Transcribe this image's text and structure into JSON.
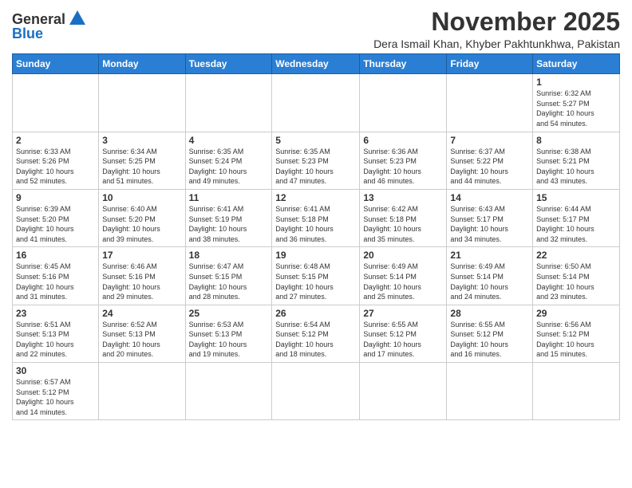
{
  "header": {
    "logo_general": "General",
    "logo_blue": "Blue",
    "month_title": "November 2025",
    "subtitle": "Dera Ismail Khan, Khyber Pakhtunkhwa, Pakistan"
  },
  "weekdays": [
    "Sunday",
    "Monday",
    "Tuesday",
    "Wednesday",
    "Thursday",
    "Friday",
    "Saturday"
  ],
  "weeks": [
    [
      {
        "day": "",
        "info": ""
      },
      {
        "day": "",
        "info": ""
      },
      {
        "day": "",
        "info": ""
      },
      {
        "day": "",
        "info": ""
      },
      {
        "day": "",
        "info": ""
      },
      {
        "day": "",
        "info": ""
      },
      {
        "day": "1",
        "info": "Sunrise: 6:32 AM\nSunset: 5:27 PM\nDaylight: 10 hours\nand 54 minutes."
      }
    ],
    [
      {
        "day": "2",
        "info": "Sunrise: 6:33 AM\nSunset: 5:26 PM\nDaylight: 10 hours\nand 52 minutes."
      },
      {
        "day": "3",
        "info": "Sunrise: 6:34 AM\nSunset: 5:25 PM\nDaylight: 10 hours\nand 51 minutes."
      },
      {
        "day": "4",
        "info": "Sunrise: 6:35 AM\nSunset: 5:24 PM\nDaylight: 10 hours\nand 49 minutes."
      },
      {
        "day": "5",
        "info": "Sunrise: 6:35 AM\nSunset: 5:23 PM\nDaylight: 10 hours\nand 47 minutes."
      },
      {
        "day": "6",
        "info": "Sunrise: 6:36 AM\nSunset: 5:23 PM\nDaylight: 10 hours\nand 46 minutes."
      },
      {
        "day": "7",
        "info": "Sunrise: 6:37 AM\nSunset: 5:22 PM\nDaylight: 10 hours\nand 44 minutes."
      },
      {
        "day": "8",
        "info": "Sunrise: 6:38 AM\nSunset: 5:21 PM\nDaylight: 10 hours\nand 43 minutes."
      }
    ],
    [
      {
        "day": "9",
        "info": "Sunrise: 6:39 AM\nSunset: 5:20 PM\nDaylight: 10 hours\nand 41 minutes."
      },
      {
        "day": "10",
        "info": "Sunrise: 6:40 AM\nSunset: 5:20 PM\nDaylight: 10 hours\nand 39 minutes."
      },
      {
        "day": "11",
        "info": "Sunrise: 6:41 AM\nSunset: 5:19 PM\nDaylight: 10 hours\nand 38 minutes."
      },
      {
        "day": "12",
        "info": "Sunrise: 6:41 AM\nSunset: 5:18 PM\nDaylight: 10 hours\nand 36 minutes."
      },
      {
        "day": "13",
        "info": "Sunrise: 6:42 AM\nSunset: 5:18 PM\nDaylight: 10 hours\nand 35 minutes."
      },
      {
        "day": "14",
        "info": "Sunrise: 6:43 AM\nSunset: 5:17 PM\nDaylight: 10 hours\nand 34 minutes."
      },
      {
        "day": "15",
        "info": "Sunrise: 6:44 AM\nSunset: 5:17 PM\nDaylight: 10 hours\nand 32 minutes."
      }
    ],
    [
      {
        "day": "16",
        "info": "Sunrise: 6:45 AM\nSunset: 5:16 PM\nDaylight: 10 hours\nand 31 minutes."
      },
      {
        "day": "17",
        "info": "Sunrise: 6:46 AM\nSunset: 5:16 PM\nDaylight: 10 hours\nand 29 minutes."
      },
      {
        "day": "18",
        "info": "Sunrise: 6:47 AM\nSunset: 5:15 PM\nDaylight: 10 hours\nand 28 minutes."
      },
      {
        "day": "19",
        "info": "Sunrise: 6:48 AM\nSunset: 5:15 PM\nDaylight: 10 hours\nand 27 minutes."
      },
      {
        "day": "20",
        "info": "Sunrise: 6:49 AM\nSunset: 5:14 PM\nDaylight: 10 hours\nand 25 minutes."
      },
      {
        "day": "21",
        "info": "Sunrise: 6:49 AM\nSunset: 5:14 PM\nDaylight: 10 hours\nand 24 minutes."
      },
      {
        "day": "22",
        "info": "Sunrise: 6:50 AM\nSunset: 5:14 PM\nDaylight: 10 hours\nand 23 minutes."
      }
    ],
    [
      {
        "day": "23",
        "info": "Sunrise: 6:51 AM\nSunset: 5:13 PM\nDaylight: 10 hours\nand 22 minutes."
      },
      {
        "day": "24",
        "info": "Sunrise: 6:52 AM\nSunset: 5:13 PM\nDaylight: 10 hours\nand 20 minutes."
      },
      {
        "day": "25",
        "info": "Sunrise: 6:53 AM\nSunset: 5:13 PM\nDaylight: 10 hours\nand 19 minutes."
      },
      {
        "day": "26",
        "info": "Sunrise: 6:54 AM\nSunset: 5:12 PM\nDaylight: 10 hours\nand 18 minutes."
      },
      {
        "day": "27",
        "info": "Sunrise: 6:55 AM\nSunset: 5:12 PM\nDaylight: 10 hours\nand 17 minutes."
      },
      {
        "day": "28",
        "info": "Sunrise: 6:55 AM\nSunset: 5:12 PM\nDaylight: 10 hours\nand 16 minutes."
      },
      {
        "day": "29",
        "info": "Sunrise: 6:56 AM\nSunset: 5:12 PM\nDaylight: 10 hours\nand 15 minutes."
      }
    ],
    [
      {
        "day": "30",
        "info": "Sunrise: 6:57 AM\nSunset: 5:12 PM\nDaylight: 10 hours\nand 14 minutes."
      },
      {
        "day": "",
        "info": ""
      },
      {
        "day": "",
        "info": ""
      },
      {
        "day": "",
        "info": ""
      },
      {
        "day": "",
        "info": ""
      },
      {
        "day": "",
        "info": ""
      },
      {
        "day": "",
        "info": ""
      }
    ]
  ]
}
